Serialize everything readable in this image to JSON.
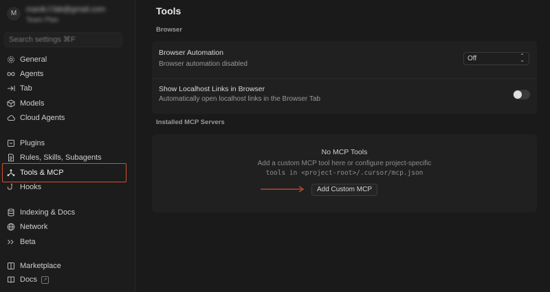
{
  "account": {
    "avatar_letter": "M",
    "email": "manik.f.fab@gmail.com",
    "plan": "Team Plan"
  },
  "search": {
    "placeholder": "Search settings ⌘F"
  },
  "sidebar": {
    "items": [
      {
        "label": "General",
        "icon": "gear-icon"
      },
      {
        "label": "Agents",
        "icon": "infinity-icon"
      },
      {
        "label": "Tab",
        "icon": "tab-arrow-icon"
      },
      {
        "label": "Models",
        "icon": "cube-icon"
      },
      {
        "label": "Cloud Agents",
        "icon": "cloud-icon"
      },
      {
        "label": "Plugins",
        "icon": "plugin-icon"
      },
      {
        "label": "Rules, Skills, Subagents",
        "icon": "document-icon"
      },
      {
        "label": "Tools & MCP",
        "icon": "tools-network-icon"
      },
      {
        "label": "Hooks",
        "icon": "hook-icon"
      },
      {
        "label": "Indexing & Docs",
        "icon": "database-icon"
      },
      {
        "label": "Network",
        "icon": "globe-icon"
      },
      {
        "label": "Beta",
        "icon": "chevrons-icon"
      },
      {
        "label": "Marketplace",
        "icon": "marketplace-icon"
      },
      {
        "label": "Docs",
        "icon": "book-icon",
        "external": "↗"
      }
    ],
    "active": "Tools & MCP"
  },
  "main": {
    "title": "Tools",
    "browser_section": "Browser",
    "browser_automation": {
      "title": "Browser Automation",
      "subtitle": "Browser automation disabled",
      "value": "Off"
    },
    "localhost_links": {
      "title": "Show Localhost Links in Browser",
      "subtitle": "Automatically open localhost links in the Browser Tab",
      "enabled": false
    },
    "mcp_section": "Installed MCP Servers",
    "mcp": {
      "empty_title": "No MCP Tools",
      "desc_line1": "Add a custom MCP tool here or configure project-specific",
      "desc_line2": "tools in <project-root>/.cursor/mcp.json",
      "button_label": "Add Custom MCP"
    }
  },
  "colors": {
    "accent_highlight": "#d2522c",
    "background": "#1a1a1a",
    "card": "#202020"
  }
}
